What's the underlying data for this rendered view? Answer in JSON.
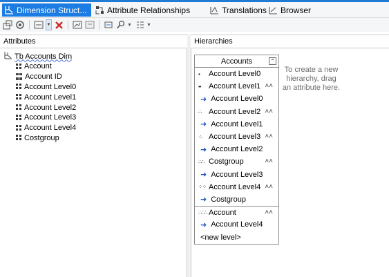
{
  "tabs": [
    {
      "label": "Dimension Struct...",
      "icon": "dimension-structure-icon",
      "active": true
    },
    {
      "label": "Attribute Relationships",
      "icon": "attribute-relationships-icon",
      "active": false
    },
    {
      "label": "Translations",
      "icon": "translations-icon",
      "active": false
    },
    {
      "label": "Browser",
      "icon": "browser-icon",
      "active": false
    }
  ],
  "panels": {
    "attributes_title": "Attributes",
    "hierarchies_title": "Hierarchies"
  },
  "attribute_tree": {
    "root_label": "Tb Accounts Dim",
    "items": [
      {
        "label": "Account",
        "icon": "grid"
      },
      {
        "label": "Account ID",
        "icon": "key"
      },
      {
        "label": "Account Level0",
        "icon": "grid"
      },
      {
        "label": "Account Level1",
        "icon": "grid"
      },
      {
        "label": "Account Level2",
        "icon": "grid"
      },
      {
        "label": "Account Level3",
        "icon": "grid"
      },
      {
        "label": "Account Level4",
        "icon": "grid"
      },
      {
        "label": "Costgroup",
        "icon": "grid"
      }
    ]
  },
  "hierarchy": {
    "name": "Accounts",
    "rows": [
      {
        "kind": "level",
        "label": "Account Level0",
        "dots": "•",
        "chevron": false
      },
      {
        "kind": "level",
        "label": "Account Level1",
        "dots": "••",
        "chevron": true
      },
      {
        "kind": "attr",
        "label": "Account Level0"
      },
      {
        "kind": "level",
        "label": "Account Level2",
        "dots": "∴",
        "chevron": true
      },
      {
        "kind": "attr",
        "label": "Account Level1"
      },
      {
        "kind": "level",
        "label": "Account Level3",
        "dots": "⁘",
        "chevron": true
      },
      {
        "kind": "attr",
        "label": "Account Level2"
      },
      {
        "kind": "level",
        "label": "Costgroup",
        "dots": "∴∴",
        "chevron": true
      },
      {
        "kind": "attr",
        "label": "Account Level3"
      },
      {
        "kind": "level",
        "label": "Account Level4",
        "dots": "⁘⁘",
        "chevron": true
      },
      {
        "kind": "attr",
        "label": "Costgroup"
      },
      {
        "kind": "level",
        "label": "Account",
        "dots": "∴∴∴",
        "chevron": true,
        "separator": true
      },
      {
        "kind": "attr",
        "label": "Account Level4"
      },
      {
        "kind": "new",
        "label": "<new level>"
      }
    ]
  },
  "hint": "To create a new hierarchy, drag an attribute here.",
  "colors": {
    "accent": "#1b7ce3",
    "arrow": "#1f57b8"
  }
}
